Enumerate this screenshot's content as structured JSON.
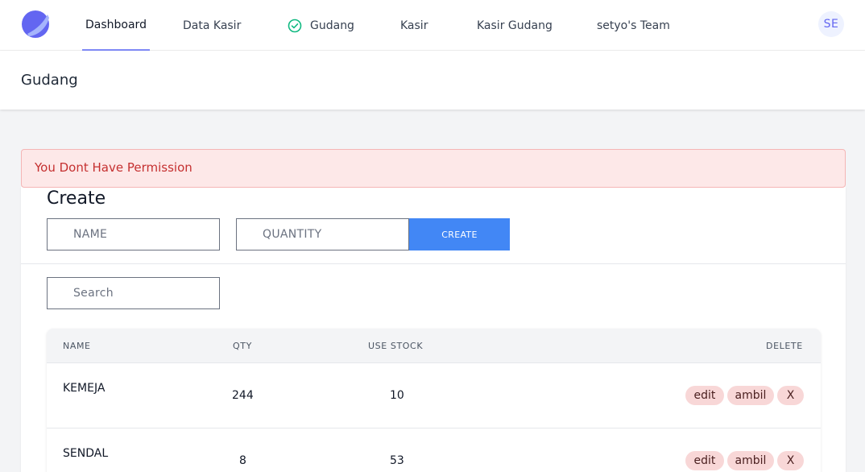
{
  "nav": {
    "items": [
      {
        "label": "Dashboard"
      },
      {
        "label": "Data Kasir"
      },
      {
        "label": "Gudang"
      },
      {
        "label": "Kasir"
      },
      {
        "label": "Kasir Gudang"
      },
      {
        "label": "setyo's Team"
      }
    ],
    "avatar_initials": "SE"
  },
  "header": {
    "title": "Gudang"
  },
  "alert": {
    "message": "You Dont Have Permission"
  },
  "create": {
    "title": "Create",
    "name_placeholder": "NAME",
    "quantity_placeholder": "QUANTITY",
    "button_label": "CREATE"
  },
  "search": {
    "placeholder": "Search"
  },
  "table": {
    "headers": {
      "name": "NAME",
      "qty": "QTY",
      "use_stock": "USE STOCK",
      "delete": "DELETE"
    },
    "rows": [
      {
        "name": "KEMEJA",
        "qty": "244",
        "use_stock": "10",
        "edit": "edit",
        "ambil": "ambil",
        "delete": "X"
      },
      {
        "name": "SENDAL",
        "qty": "8",
        "use_stock": "53",
        "edit": "edit",
        "ambil": "ambil",
        "delete": "X"
      }
    ]
  },
  "colors": {
    "accent": "#4287f5",
    "alert_bg": "#fde8e8",
    "alert_text": "#c53030",
    "pill_bg": "#f8d7d7"
  }
}
